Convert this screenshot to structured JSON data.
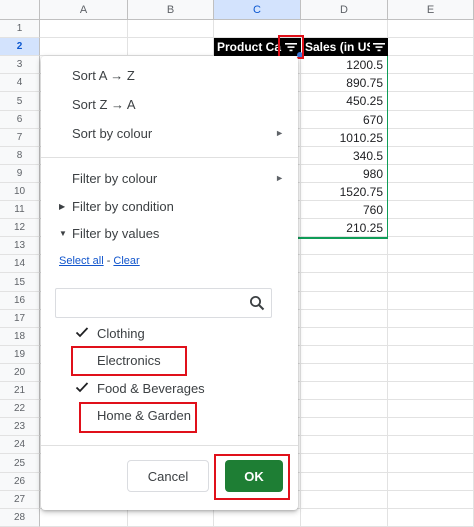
{
  "columns": [
    "A",
    "B",
    "C",
    "D",
    "E"
  ],
  "rows": [
    "1",
    "2",
    "3",
    "4",
    "5",
    "6",
    "7",
    "8",
    "9",
    "10",
    "11",
    "12",
    "13",
    "14",
    "15",
    "16",
    "17",
    "18",
    "19",
    "20",
    "21",
    "22",
    "23",
    "24",
    "25",
    "26",
    "27",
    "28"
  ],
  "header_row": {
    "product_category": "Product Ca",
    "sales": "Sales (in US"
  },
  "sales_values": [
    "1200.5",
    "890.75",
    "450.25",
    "670",
    "1010.25",
    "340.5",
    "980",
    "1520.75",
    "760",
    "210.25"
  ],
  "menu": {
    "sort_az": "Sort A → Z",
    "sort_za": "Sort Z → A",
    "sort_by_colour": "Sort by colour",
    "filter_by_colour": "Filter by colour",
    "filter_by_condition": "Filter by condition",
    "filter_by_values": "Filter by values",
    "select_all": "Select all",
    "links_separator": " - ",
    "clear": "Clear",
    "search_placeholder": "",
    "values": [
      {
        "label": "Clothing",
        "checked": true
      },
      {
        "label": "Electronics",
        "checked": false
      },
      {
        "label": "Food & Beverages",
        "checked": true
      },
      {
        "label": "Home & Garden",
        "checked": false
      }
    ],
    "cancel": "Cancel",
    "ok": "OK"
  },
  "colors": {
    "header_bg": "#000000",
    "ok_button": "#1e7e34",
    "selection_blue": "#d3e3fd",
    "range_border": "#0f9d58",
    "annotation_red": "#e0101a"
  }
}
